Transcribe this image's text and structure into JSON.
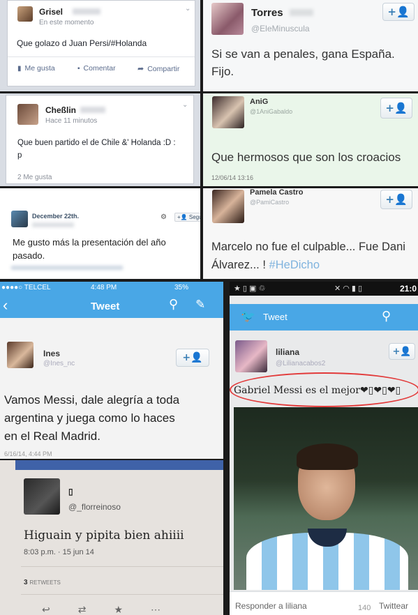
{
  "p1": {
    "name": "Grisel",
    "meta": "En este momento",
    "text": "Que golazo d Juan Persi/#Holanda",
    "like": "Me gusta",
    "comment": "Comentar",
    "share": "Compartir"
  },
  "p2": {
    "name": "Torres",
    "handle": "@EleMinuscula",
    "text_line1": "Si se van a penales, gana España.",
    "text_line2": "Fijo."
  },
  "p3": {
    "name": "Cheßlin",
    "meta": "Hace 11 minutos",
    "text_line1": "Que buen partido el de Chile &' Holanda :D :",
    "text_line2": "p",
    "likes": "2 Me gusta"
  },
  "p4": {
    "name": "AniG",
    "handle": "@1AniGabaldo",
    "text": "Que hermosos que son los croacios",
    "timestamp": "12/06/14 13:16"
  },
  "p5": {
    "name": "December 22th.",
    "follow": "Segui",
    "text_line1": "Me gusto más la presentación del año",
    "text_line2": "pasado."
  },
  "p6": {
    "name": "Pamela Castro",
    "handle": "@PamiCastro",
    "text_line1": "Marcelo no fue el culpable... Fue Dani",
    "text_line2": "Álvarez... !",
    "hashtag": "#HeDicho"
  },
  "p7": {
    "carrier": "●●●●○ TELCEL",
    "time": "4:48 PM",
    "battery": "35%",
    "title": "Tweet",
    "name": "Ines",
    "handle": "@Ines_nc",
    "text_line1": "Vamos Messi, dale alegría a toda",
    "text_line2": "argentina y juega como lo haces",
    "text_line3": "en el Real Madrid.",
    "timestamp": "6/16/14, 4:44 PM"
  },
  "p8": {
    "clock": "21:0",
    "title": "Tweet",
    "name": "liliana",
    "handle": "@Lilianacabos2",
    "text": "Gabriel Messi es el mejor❤▯❤▯❤▯",
    "reply_placeholder": "Responder a liliana",
    "char_count": "140",
    "tweet_button": "Twittear"
  },
  "p9": {
    "name": "▯",
    "handle": "@_florreinoso",
    "text": "Higuain y pipita bien ahiiii",
    "timestamp": "8:03 p.m. · 15 jun 14",
    "retweets_count": "3",
    "retweets_label": "RETWEETS"
  },
  "colors": {
    "twitter_blue": "#49a7e6",
    "fb_link": "#5a6b8c",
    "hashtag": "#7fb3de",
    "red_circle": "#e23a3a"
  }
}
